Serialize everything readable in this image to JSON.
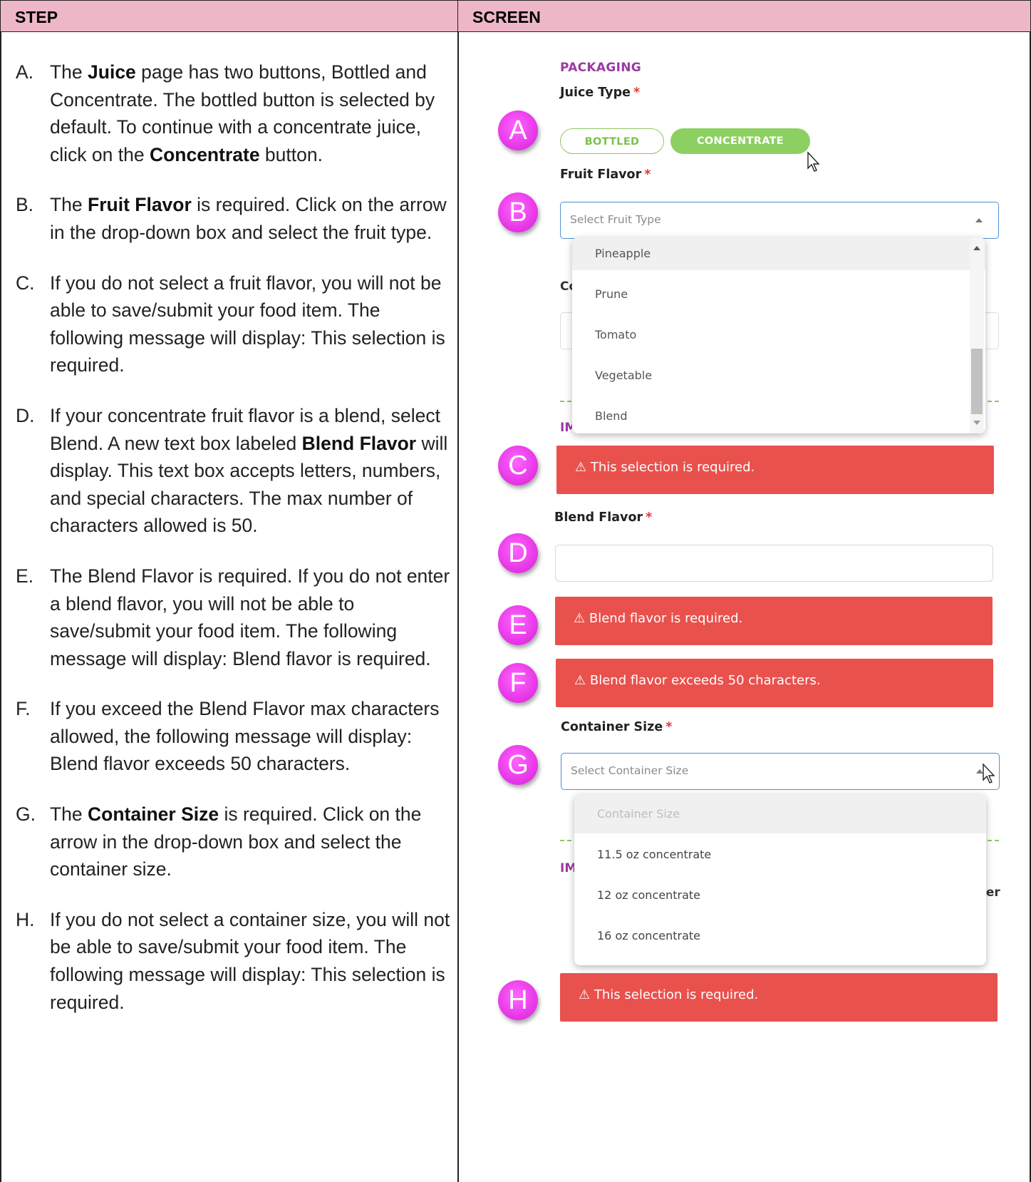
{
  "table": {
    "header_step": "STEP",
    "header_screen": "SCREEN"
  },
  "steps": [
    {
      "letter": "A.",
      "parts": [
        "The ",
        "Juice",
        " page has two buttons, Bottled and Concentrate.  The bottled button is selected by default.  To continue with a concentrate juice, click on the ",
        "Concentrate",
        " button."
      ]
    },
    {
      "letter": "B.",
      "parts": [
        "The ",
        "Fruit Flavor",
        " is required.  Click on the arrow in the drop-down box and select the fruit type.",
        "",
        ""
      ]
    },
    {
      "letter": "C.",
      "parts": [
        "If you do not select a fruit flavor, you will not be able to save/submit your food item.  The following message will display:  This selection is required.",
        "",
        "",
        "",
        ""
      ]
    },
    {
      "letter": "D.",
      "parts": [
        "If your concentrate fruit flavor is a blend, select Blend.  A new text box labeled ",
        "Blend Flavor",
        " will display.  This text box accepts letters, numbers, and special characters.  The max number of characters allowed is 50.",
        "",
        ""
      ]
    },
    {
      "letter": "E.",
      "parts": [
        "The Blend Flavor is required. If you do not enter a blend flavor, you will not be able to save/submit your food item. The following message will display:  Blend flavor is required.",
        "",
        "",
        "",
        ""
      ]
    },
    {
      "letter": "F.",
      "parts": [
        "If you exceed the Blend Flavor max characters allowed, the following message will display:  Blend flavor exceeds 50 characters.",
        "",
        "",
        "",
        ""
      ]
    },
    {
      "letter": "G.",
      "parts": [
        "The ",
        "Container Size",
        " is required.  Click on the arrow in the drop-down box and select the container size.",
        "",
        ""
      ]
    },
    {
      "letter": "H.",
      "parts": [
        "If you do not select a container size, you will not be able to save/submit your food item. The following message will display:  This selection is required.",
        "",
        "",
        "",
        ""
      ]
    }
  ],
  "screen": {
    "section_title": "PACKAGING",
    "juice_type_label": "Juice Type",
    "required_mark": "*",
    "bottled_label": "BOTTLED",
    "concentrate_label": "CONCENTRATE",
    "fruit_flavor_label": "Fruit Flavor",
    "fruit_placeholder": "Select Fruit Type",
    "fruit_options": [
      "Pineapple",
      "Prune",
      "Tomato",
      "Vegetable",
      "Blend"
    ],
    "behind_label_1": "Co",
    "behind_label_2": "IM",
    "alert_c": "⚠ This selection is required.",
    "blend_flavor_label": "Blend Flavor",
    "alert_e": "⚠ Blend flavor is required.",
    "alert_f": "⚠ Blend flavor exceeds 50 characters.",
    "container_size_label": "Container Size",
    "container_placeholder": "Select Container Size",
    "container_options": [
      "Container Size",
      "11.5 oz concentrate",
      "12 oz concentrate",
      "16 oz concentrate"
    ],
    "behind_label_3": "IM",
    "behind_label_4": "ier",
    "alert_h": "⚠ This selection is required.",
    "badges": [
      "A",
      "B",
      "C",
      "D",
      "E",
      "F",
      "G",
      "H"
    ]
  }
}
